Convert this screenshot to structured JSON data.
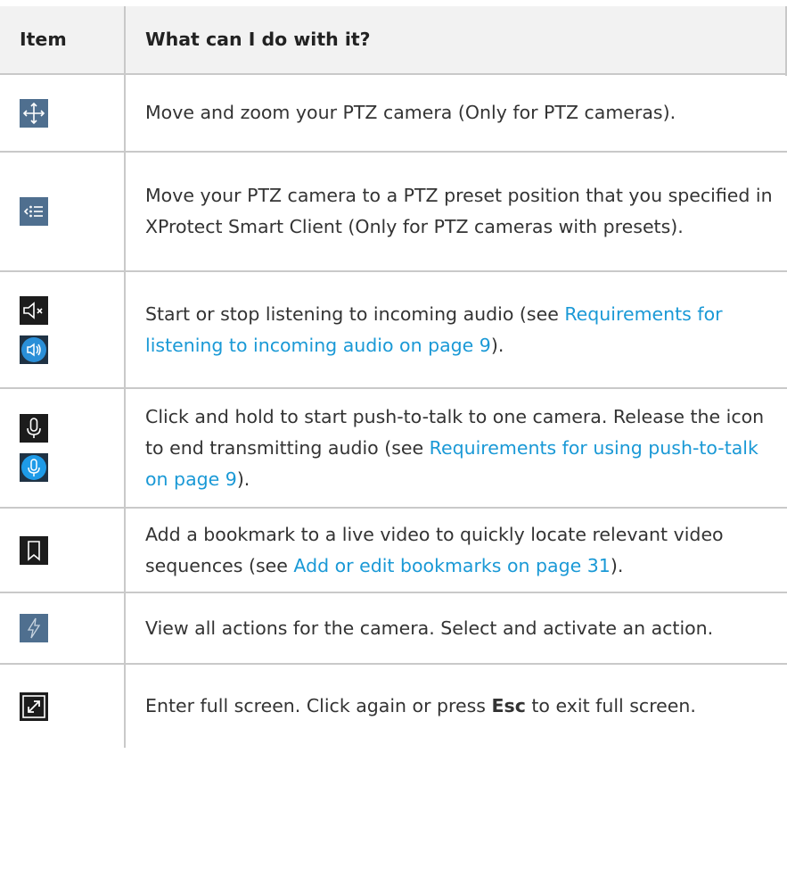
{
  "header": {
    "col1": "Item",
    "col2": "What can I do with it?"
  },
  "rows": [
    {
      "icons": [
        "ptz-move-icon"
      ],
      "text": "Move and zoom your PTZ camera (Only for PTZ cameras)."
    },
    {
      "icons": [
        "ptz-preset-icon"
      ],
      "text": "Move your PTZ camera to a PTZ preset position that you specified in XProtect Smart Client (Only for PTZ cameras with presets)."
    },
    {
      "icons": [
        "speaker-muted-icon",
        "speaker-on-icon"
      ],
      "text_before": "Start or stop listening to incoming audio (see ",
      "link": "Requirements for listening to incoming audio on page 9",
      "text_after": ")."
    },
    {
      "icons": [
        "microphone-icon",
        "microphone-active-icon"
      ],
      "text_before": "Click and hold to start push-to-talk to one camera. Release the icon to end transmitting audio (see ",
      "link": "Requirements for using push-to-talk on page 9",
      "text_after": ")."
    },
    {
      "icons": [
        "bookmark-icon"
      ],
      "text_before": "Add a bookmark to a live video to quickly locate relevant video sequences (see ",
      "link": "Add or edit bookmarks on page 31",
      "text_after": ")."
    },
    {
      "icons": [
        "actions-icon"
      ],
      "text": "View all actions for the camera. Select and activate an action."
    },
    {
      "icons": [
        "fullscreen-icon"
      ],
      "text_before": "Enter full screen. Click again or press ",
      "bold": "Esc",
      "text_after": " to exit full screen."
    }
  ]
}
